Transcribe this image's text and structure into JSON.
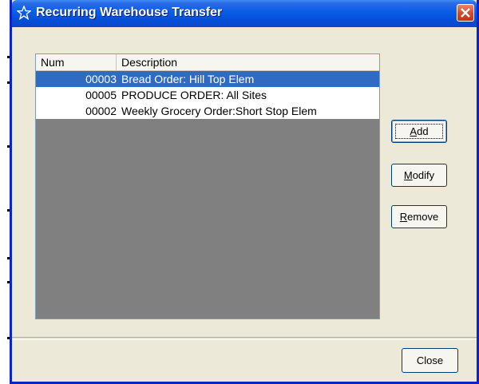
{
  "window": {
    "title": "Recurring Warehouse Transfer"
  },
  "list": {
    "columns": [
      "Num",
      "Description"
    ],
    "rows": [
      {
        "num": "00003",
        "description": "Bread Order: Hill Top Elem",
        "selected": true
      },
      {
        "num": "00005",
        "description": "PRODUCE ORDER: All Sites",
        "selected": false
      },
      {
        "num": "00002",
        "description": "Weekly Grocery Order:Short Stop Elem",
        "selected": false
      }
    ]
  },
  "buttons": {
    "add": {
      "mnemonic": "A",
      "rest": "dd"
    },
    "modify": {
      "mnemonic": "M",
      "rest": "odify"
    },
    "remove": {
      "mnemonic": "R",
      "rest": "emove"
    },
    "close": "Close"
  },
  "colors": {
    "selection": "#316ac5",
    "titlebar": "#0550dc",
    "dialog_bg": "#ece9d8",
    "list_empty_bg": "#808080"
  },
  "icons": {
    "title": "star-outline-icon",
    "close": "close-x-icon"
  }
}
